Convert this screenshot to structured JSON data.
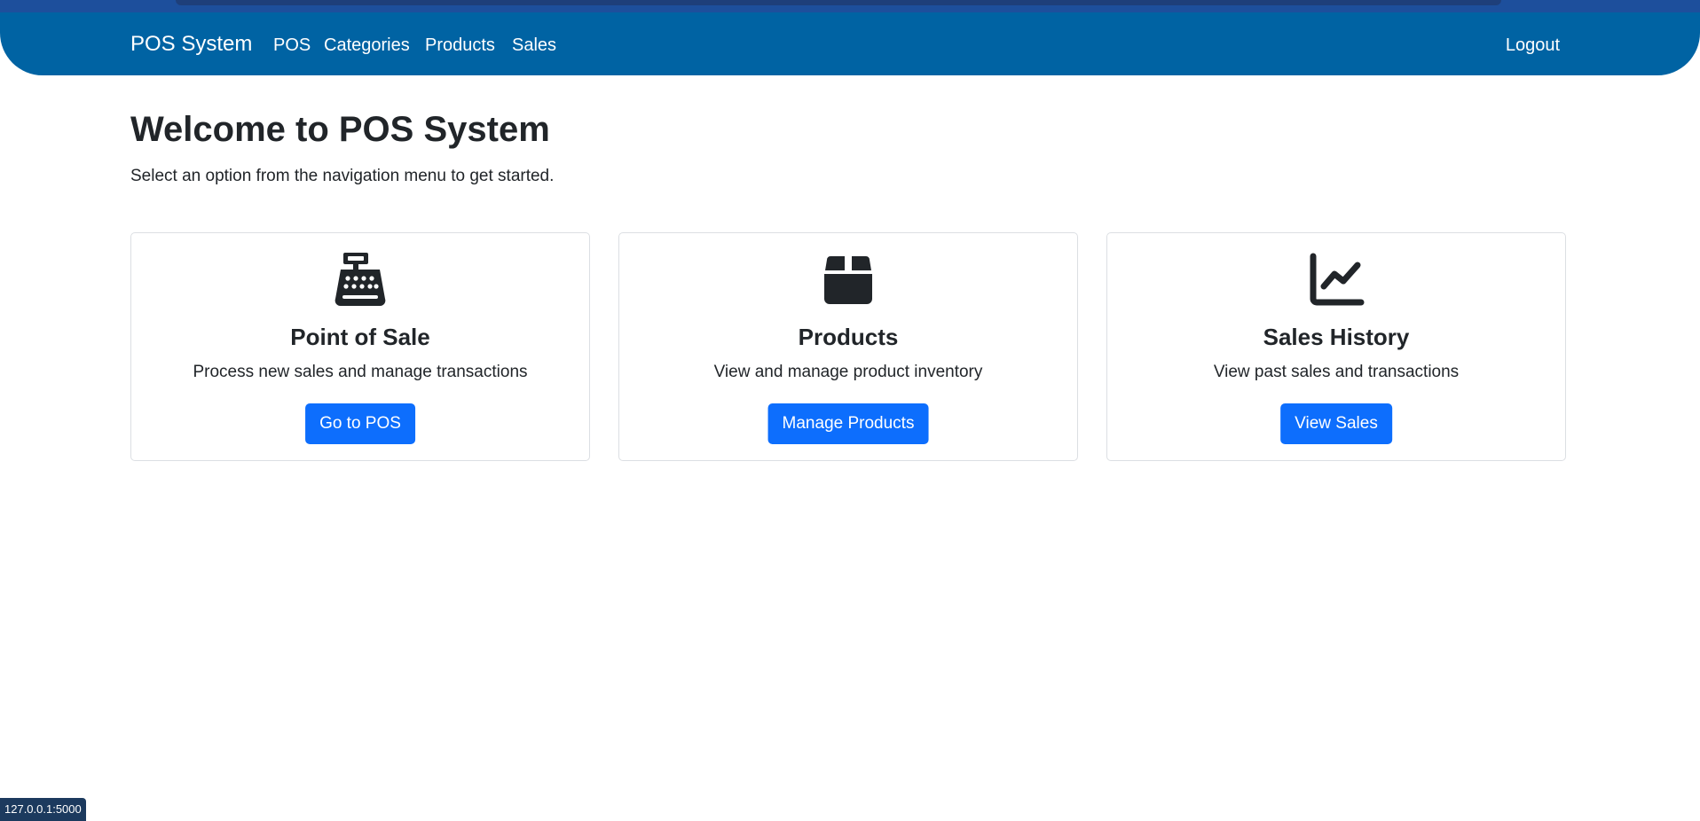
{
  "navbar": {
    "brand": "POS System",
    "links": [
      {
        "label": "POS"
      },
      {
        "label": "Categories"
      },
      {
        "label": "Products"
      },
      {
        "label": "Sales"
      }
    ],
    "logout": "Logout",
    "color": "#0063a3"
  },
  "main": {
    "title": "Welcome to POS System",
    "subtitle": "Select an option from the navigation menu to get started."
  },
  "cards": [
    {
      "icon": "cash-register-icon",
      "title": "Point of Sale",
      "text": "Process new sales and manage transactions",
      "button": "Go to POS"
    },
    {
      "icon": "box-icon",
      "title": "Products",
      "text": "View and manage product inventory",
      "button": "Manage Products"
    },
    {
      "icon": "chart-line-icon",
      "title": "Sales History",
      "text": "View past sales and transactions",
      "button": "View Sales"
    }
  ],
  "status_bar": {
    "url": "127.0.0.1:5000"
  },
  "colors": {
    "accent": "#0d6efd",
    "text": "#212529"
  }
}
